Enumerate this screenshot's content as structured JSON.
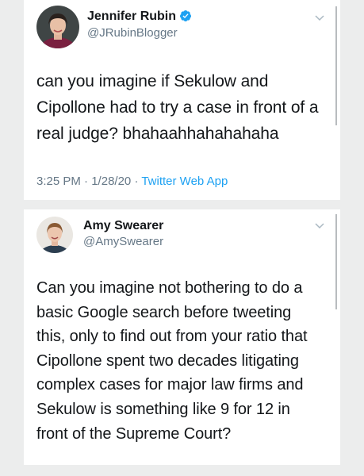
{
  "tweets": [
    {
      "author": {
        "name": "Jennifer Rubin",
        "handle": "@JRubinBlogger",
        "verified": true,
        "avatar": "profile-photo"
      },
      "text": "can you imagine if Sekulow and Cipollone had to try a case in front of a real judge? bhahaahhahahahaha",
      "time": "3:25 PM",
      "separator": "·",
      "date": "1/28/20",
      "source": "Twitter Web App"
    },
    {
      "author": {
        "name": "Amy Swearer",
        "handle": "@AmySwearer",
        "verified": false,
        "avatar": "profile-photo"
      },
      "text": "Can you imagine not bothering to do a basic Google search before tweeting this, only to find out from your ratio that Cipollone spent two decades litigating complex cases for major law firms and Sekulow is something like 9 for 12 in front of the Supreme Court?"
    }
  ],
  "colors": {
    "background": "#eceded",
    "card": "#ffffff",
    "text": "#14171a",
    "secondary": "#657786",
    "link": "#1da1f2",
    "verified_badge": "#1da1f2"
  },
  "icons": {
    "verified": "verified-badge-icon",
    "caret": "chevron-down-icon"
  }
}
